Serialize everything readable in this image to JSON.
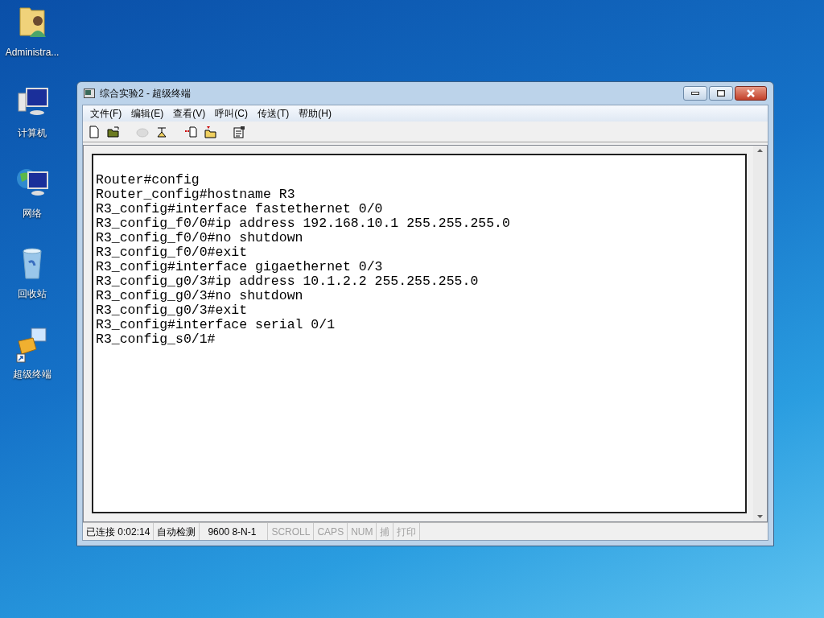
{
  "desktop_icons": [
    {
      "kind": "user-folder",
      "label": "Administra..."
    },
    {
      "kind": "computer",
      "label": "计算机"
    },
    {
      "kind": "network",
      "label": "网络"
    },
    {
      "kind": "recycle-bin",
      "label": "回收站"
    },
    {
      "kind": "terminal-shortcut",
      "label": "超级终端"
    }
  ],
  "window": {
    "title": "综合实验2 - 超级终端"
  },
  "menu": [
    "文件(F)",
    "编辑(E)",
    "查看(V)",
    "呼叫(C)",
    "传送(T)",
    "帮助(H)"
  ],
  "toolbar": [
    {
      "kind": "new",
      "disabled": false
    },
    {
      "kind": "open",
      "disabled": false
    },
    {
      "kind": "call",
      "disabled": true
    },
    {
      "kind": "hangup",
      "disabled": false
    },
    {
      "kind": "send",
      "disabled": false
    },
    {
      "kind": "receive",
      "disabled": false
    },
    {
      "kind": "properties",
      "disabled": false
    }
  ],
  "terminal_lines": [
    "Router#config",
    "Router_config#hostname R3",
    "R3_config#interface fastethernet 0/0",
    "R3_config_f0/0#ip address 192.168.10.1 255.255.255.0",
    "R3_config_f0/0#no shutdown",
    "R3_config_f0/0#exit",
    "R3_config#interface gigaethernet 0/3",
    "R3_config_g0/3#ip address 10.1.2.2 255.255.255.0",
    "R3_config_g0/3#no shutdown",
    "R3_config_g0/3#exit",
    "R3_config#interface serial 0/1",
    "R3_config_s0/1#"
  ],
  "status_bar": [
    {
      "text": "已连接 0:02:14",
      "disabled": false
    },
    {
      "text": "自动检测",
      "disabled": false
    },
    {
      "text": "9600 8-N-1",
      "disabled": false
    },
    {
      "text": "SCROLL",
      "disabled": true
    },
    {
      "text": "CAPS",
      "disabled": true
    },
    {
      "text": "NUM",
      "disabled": true
    },
    {
      "text": "捕",
      "disabled": true
    },
    {
      "text": "打印",
      "disabled": true
    }
  ]
}
